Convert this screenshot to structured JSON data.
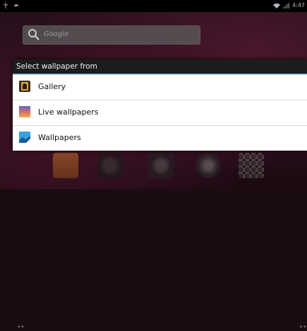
{
  "status_bar": {
    "time": "4:47"
  },
  "search": {
    "placeholder": "Google"
  },
  "dialog": {
    "title": "Select wallpaper from",
    "options": [
      {
        "label": "Gallery",
        "icon": "gallery-icon"
      },
      {
        "label": "Live wallpapers",
        "icon": "live-wallpapers-icon"
      },
      {
        "label": "Wallpapers",
        "icon": "wallpapers-icon"
      }
    ]
  },
  "colors": {
    "dialog_title_bg": "#1c1c1c",
    "dialog_bg": "#ffffff",
    "accent": "#3aa3d8"
  },
  "dock_icons": [
    "contacts-icon",
    "music-icon",
    "camera-icon",
    "browser-icon",
    "apps-grid-icon"
  ]
}
